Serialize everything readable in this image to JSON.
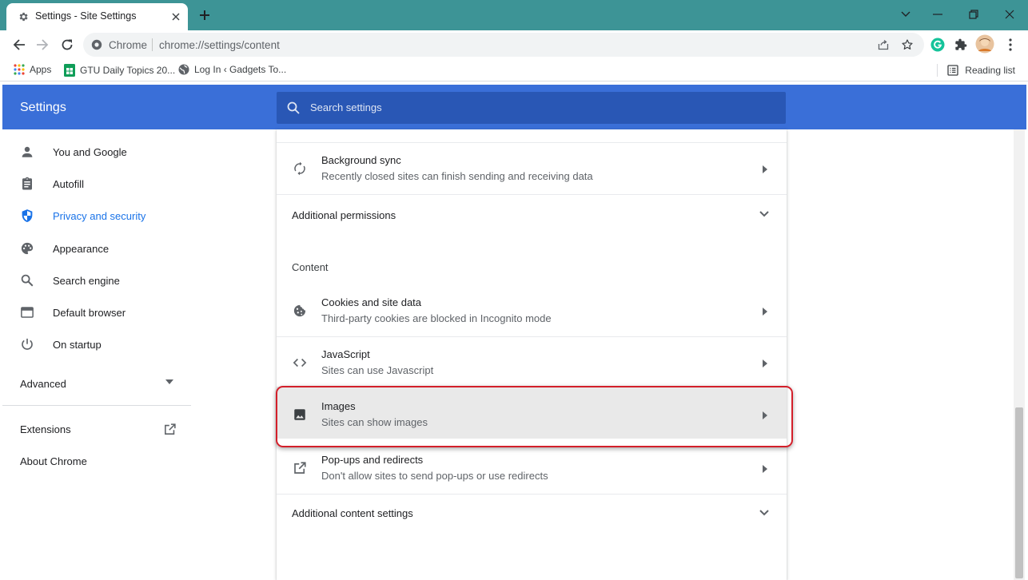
{
  "tab": {
    "title": "Settings - Site Settings"
  },
  "omnibox": {
    "site_label": "Chrome",
    "url": "chrome://settings/content"
  },
  "bookmarks": [
    {
      "label": "Apps"
    },
    {
      "label": "GTU Daily Topics 20..."
    },
    {
      "label": "Log In ‹ Gadgets To..."
    }
  ],
  "reading_list": "Reading list",
  "header": {
    "title": "Settings",
    "search_placeholder": "Search settings"
  },
  "sidebar": {
    "items": [
      {
        "label": "You and Google",
        "icon": "person-icon"
      },
      {
        "label": "Autofill",
        "icon": "clipboard-icon"
      },
      {
        "label": "Privacy and security",
        "icon": "shield-icon",
        "active": true
      },
      {
        "label": "Appearance",
        "icon": "palette-icon"
      },
      {
        "label": "Search engine",
        "icon": "search-icon"
      },
      {
        "label": "Default browser",
        "icon": "browser-window-icon"
      },
      {
        "label": "On startup",
        "icon": "power-icon"
      }
    ],
    "advanced": "Advanced",
    "extensions": "Extensions",
    "about": "About Chrome"
  },
  "content": {
    "background_sync": {
      "title": "Background sync",
      "subtitle": "Recently closed sites can finish sending and receiving data"
    },
    "additional_permissions": "Additional permissions",
    "section_label": "Content",
    "items": [
      {
        "title": "Cookies and site data",
        "subtitle": "Third-party cookies are blocked in Incognito mode",
        "icon": "cookie-icon"
      },
      {
        "title": "JavaScript",
        "subtitle": "Sites can use Javascript",
        "icon": "code-icon"
      },
      {
        "title": "Images",
        "subtitle": "Sites can show images",
        "icon": "image-icon",
        "highlighted": true
      },
      {
        "title": "Pop-ups and redirects",
        "subtitle": "Don't allow sites to send pop-ups or use redirects",
        "icon": "open-in-new-icon"
      }
    ],
    "additional_content_settings": "Additional content settings"
  },
  "colors": {
    "titlebar": "#3d9496",
    "settings_header": "#3a6fd8",
    "search_box": "#2957b5",
    "active_nav": "#1a73e8",
    "highlight_border": "#d31f2a"
  }
}
